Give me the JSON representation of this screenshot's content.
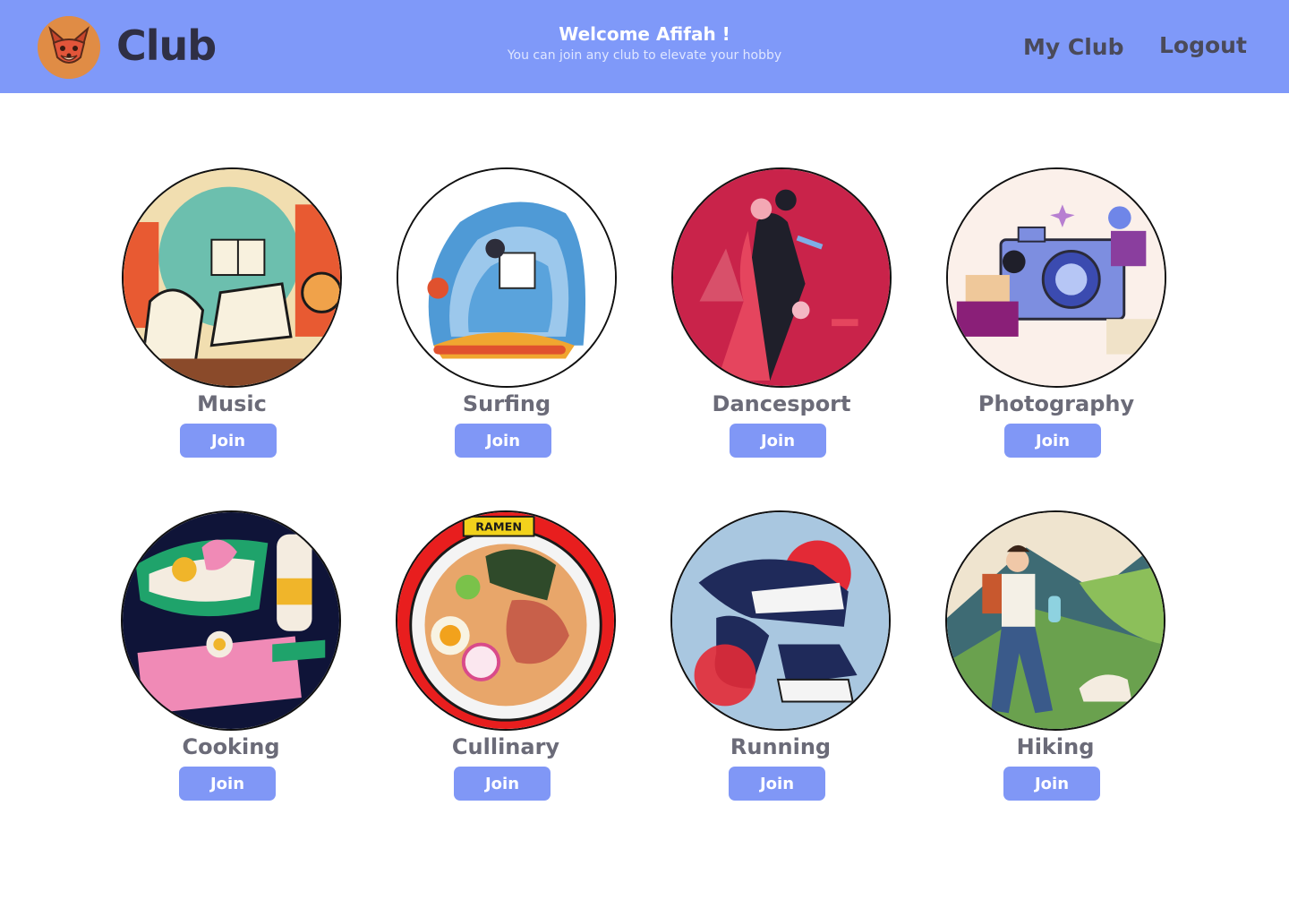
{
  "header": {
    "brand": "Club",
    "welcome_title": "Welcome Afifah !",
    "welcome_subtitle": "You can join any club to elevate your hobby",
    "nav": {
      "my_club": "My Club",
      "logout": "Logout"
    }
  },
  "colors": {
    "header_bg": "#7f99f9",
    "button_bg": "#8097f6",
    "club_name_text": "#6b6b78"
  },
  "clubs": [
    {
      "name": "Music",
      "join_label": "Join",
      "image_icon": "music-illustration-icon"
    },
    {
      "name": "Surfing",
      "join_label": "Join",
      "image_icon": "surfing-illustration-icon"
    },
    {
      "name": "Dancesport",
      "join_label": "Join",
      "image_icon": "dancesport-illustration-icon"
    },
    {
      "name": "Photography",
      "join_label": "Join",
      "image_icon": "photography-illustration-icon"
    },
    {
      "name": "Cooking",
      "join_label": "Join",
      "image_icon": "cooking-illustration-icon"
    },
    {
      "name": "Cullinary",
      "join_label": "Join",
      "image_icon": "ramen-illustration-icon",
      "sign_text": "RAMEN"
    },
    {
      "name": "Running",
      "join_label": "Join",
      "image_icon": "running-illustration-icon"
    },
    {
      "name": "Hiking",
      "join_label": "Join",
      "image_icon": "hiking-illustration-icon"
    }
  ]
}
